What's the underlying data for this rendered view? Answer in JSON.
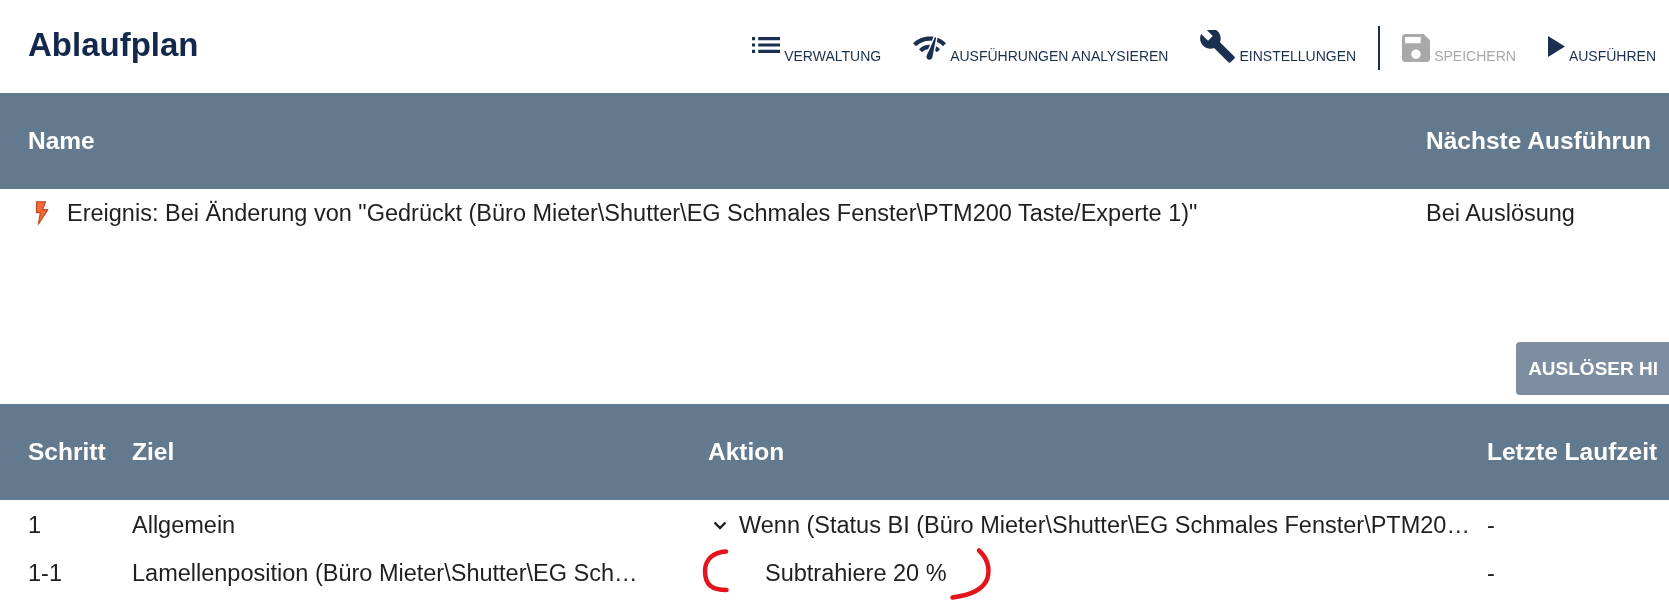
{
  "page": {
    "title": "Ablaufplan"
  },
  "toolbar": [
    {
      "buttons": [
        {
          "label": "VERWALTUNG",
          "disabled": false
        },
        {
          "label": "AUSFÜHRUNGEN ANALYSIEREN",
          "disabled": false
        },
        {
          "label": "EINSTELLUNGEN",
          "disabled": false
        }
      ]
    },
    {
      "buttons": [
        {
          "label": "SPEICHERN",
          "disabled": true
        },
        {
          "label": "AUSFÜHREN",
          "disabled": false
        }
      ]
    }
  ],
  "triggers": {
    "columns": [
      "Name",
      "Nächste Ausführun"
    ],
    "rows": [
      {
        "name": "Ereignis: Bei Änderung von \"Gedrückt (Büro Mieter\\Shutter\\EG Schmales Fenster\\PTM200 Taste/Experte 1)\"",
        "next_run": "Bei Auslösung"
      }
    ],
    "add_button": "AUSLÖSER HI"
  },
  "steps": {
    "columns": [
      "Schritt",
      "Ziel",
      "Aktion",
      "Letzte Laufzeit"
    ],
    "rows": [
      {
        "step": "1",
        "target": "Allgemein",
        "action": "Wenn (Status BI (Büro Mieter\\Shutter\\EG Schmales Fenster\\PTM20…",
        "last_run": "-",
        "expanded": true,
        "highlighted": false,
        "children": [
          {
            "step": "1-1",
            "target": "Lamellenposition (Büro Mieter\\Shutter\\EG Sch…",
            "action": "Subtrahiere 20 %",
            "last_run": "-",
            "highlighted": true
          }
        ]
      }
    ]
  }
}
